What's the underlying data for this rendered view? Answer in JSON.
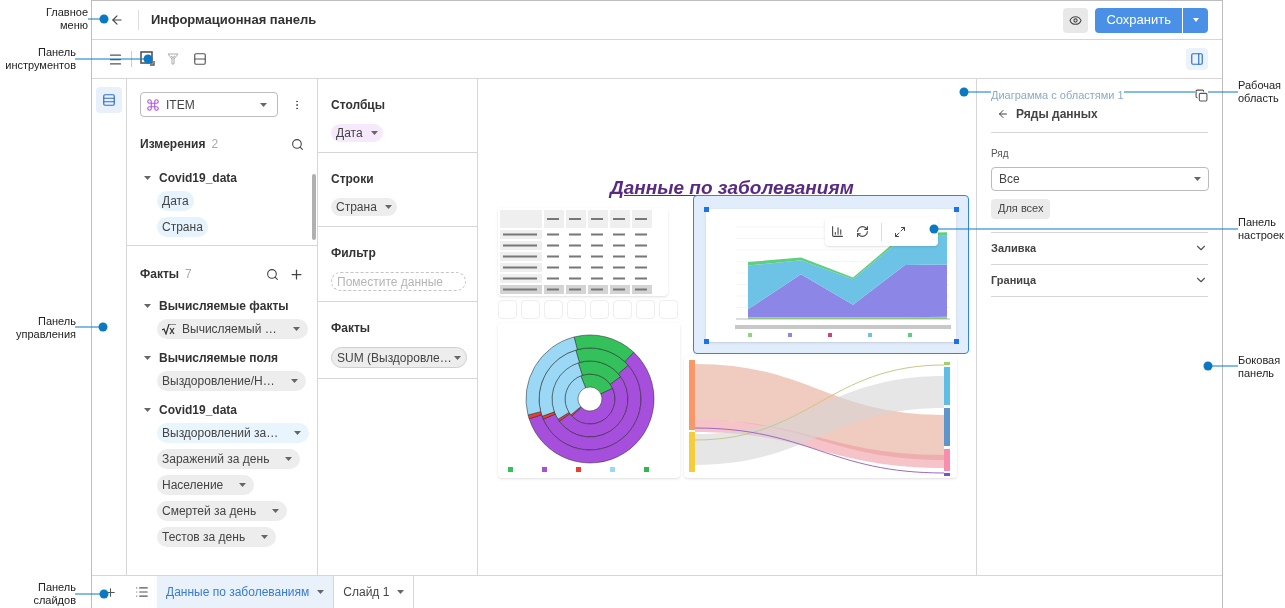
{
  "callouts": [
    {
      "label": "Главное меню"
    },
    {
      "label": "Панель инструментов"
    },
    {
      "label": "Панель управления"
    },
    {
      "label": "Панель слайдов"
    },
    {
      "label": "Рабочая область"
    },
    {
      "label": "Панель настроек"
    },
    {
      "label": "Боковая панель"
    }
  ],
  "header": {
    "title": "Информационная панель",
    "save_label": "Сохранить"
  },
  "data_panel": {
    "cube": "ITEM",
    "dimensions": {
      "title": "Измерения",
      "count": "2",
      "groups": [
        {
          "name": "Covid19_data",
          "expanded": true,
          "items": [
            {
              "label": "Дата",
              "kind": "dimension"
            },
            {
              "label": "Страна",
              "kind": "dimension"
            }
          ]
        }
      ]
    },
    "facts": {
      "title": "Факты",
      "count": "7",
      "groups": [
        {
          "name": "Вычисляемые факты",
          "expanded": true,
          "items": [
            {
              "label": "Вычисляемый …",
              "kind": "formula",
              "selected": false
            }
          ]
        },
        {
          "name": "Вычисляемые поля",
          "expanded": true,
          "items": [
            {
              "label": "Выздоровление/Н…",
              "kind": "fact",
              "selected": false
            }
          ]
        },
        {
          "name": "Covid19_data",
          "expanded": true,
          "items": [
            {
              "label": "Выздоровлений за…",
              "kind": "fact",
              "selected": true
            },
            {
              "label": "Заражений за день",
              "kind": "fact",
              "selected": false
            },
            {
              "label": "Население",
              "kind": "fact",
              "selected": false
            },
            {
              "label": "Смертей за день",
              "kind": "fact",
              "selected": false
            },
            {
              "label": "Тестов за день",
              "kind": "fact",
              "selected": false
            }
          ]
        }
      ]
    }
  },
  "field_panel": {
    "sections": [
      {
        "title": "Столбцы",
        "chips": [
          {
            "label": "Дата",
            "kind": "column"
          }
        ]
      },
      {
        "title": "Строки",
        "chips": [
          {
            "label": "Страна",
            "kind": "row"
          }
        ]
      },
      {
        "title": "Фильтр",
        "chips": [
          {
            "label": "Поместите данные",
            "kind": "placeholder"
          }
        ]
      },
      {
        "title": "Факты",
        "chips": [
          {
            "label": "SUM (Выздоровле…",
            "kind": "fact"
          }
        ]
      }
    ]
  },
  "workspace": {
    "title": "Данные по заболеваниям",
    "area_widget": {
      "selected": true
    }
  },
  "settings": {
    "widget_title": "Диаграмма с областями 1",
    "back_title": "Ряды данных",
    "field_label": "Ряд",
    "field_value": "Все",
    "apply_button": "Для всех",
    "sections": [
      {
        "label": "Заливка",
        "expanded": false
      },
      {
        "label": "Граница",
        "expanded": false
      }
    ]
  },
  "slides": [
    {
      "label": "Данные по заболеваниям",
      "selected": true
    },
    {
      "label": "Слайд 1",
      "selected": false
    }
  ]
}
